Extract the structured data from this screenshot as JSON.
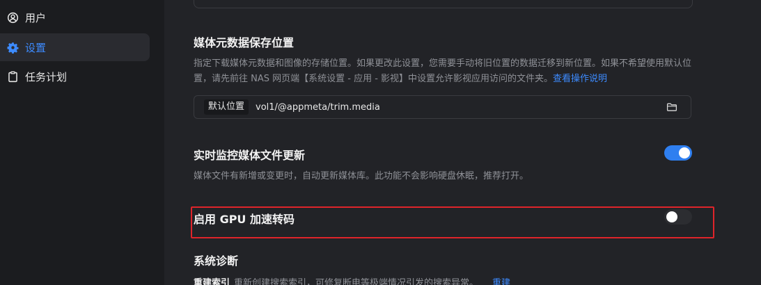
{
  "sidebar": {
    "items": [
      {
        "label": "用户",
        "icon": "user-icon",
        "active": false
      },
      {
        "label": "设置",
        "icon": "gear-icon",
        "active": true
      },
      {
        "label": "任务计划",
        "icon": "clipboard-icon",
        "active": false
      }
    ]
  },
  "metadata_location": {
    "title": "媒体元数据保存位置",
    "description": "指定下载媒体元数据和图像的存储位置。如果更改此设置，您需要手动将旧位置的数据迁移到新位置。如果不希望使用默认位置，请先前往 NAS 网页端【系统设置 - 应用 - 影视】中设置允许影视应用访问的文件夹。",
    "help_link": "查看操作说明",
    "path_tag": "默认位置",
    "path_value": "vol1/@appmeta/trim.media",
    "folder_icon": "folder-icon"
  },
  "realtime_monitor": {
    "title": "实时监控媒体文件更新",
    "description": "媒体文件有新增或变更时，自动更新媒体库。此功能不会影响硬盘休眠，推荐打开。",
    "enabled": true
  },
  "gpu_transcode": {
    "title": "启用 GPU 加速转码",
    "enabled": false
  },
  "diagnostics": {
    "title": "系统诊断",
    "rebuild_label": "重建索引",
    "rebuild_desc": "重新创建搜索索引，可修复断电等极端情况引发的搜索异常。",
    "rebuild_link": "重建"
  },
  "colors": {
    "accent": "#2f7ff0",
    "link": "#3d8bff",
    "highlight_border": "#e0242a"
  }
}
